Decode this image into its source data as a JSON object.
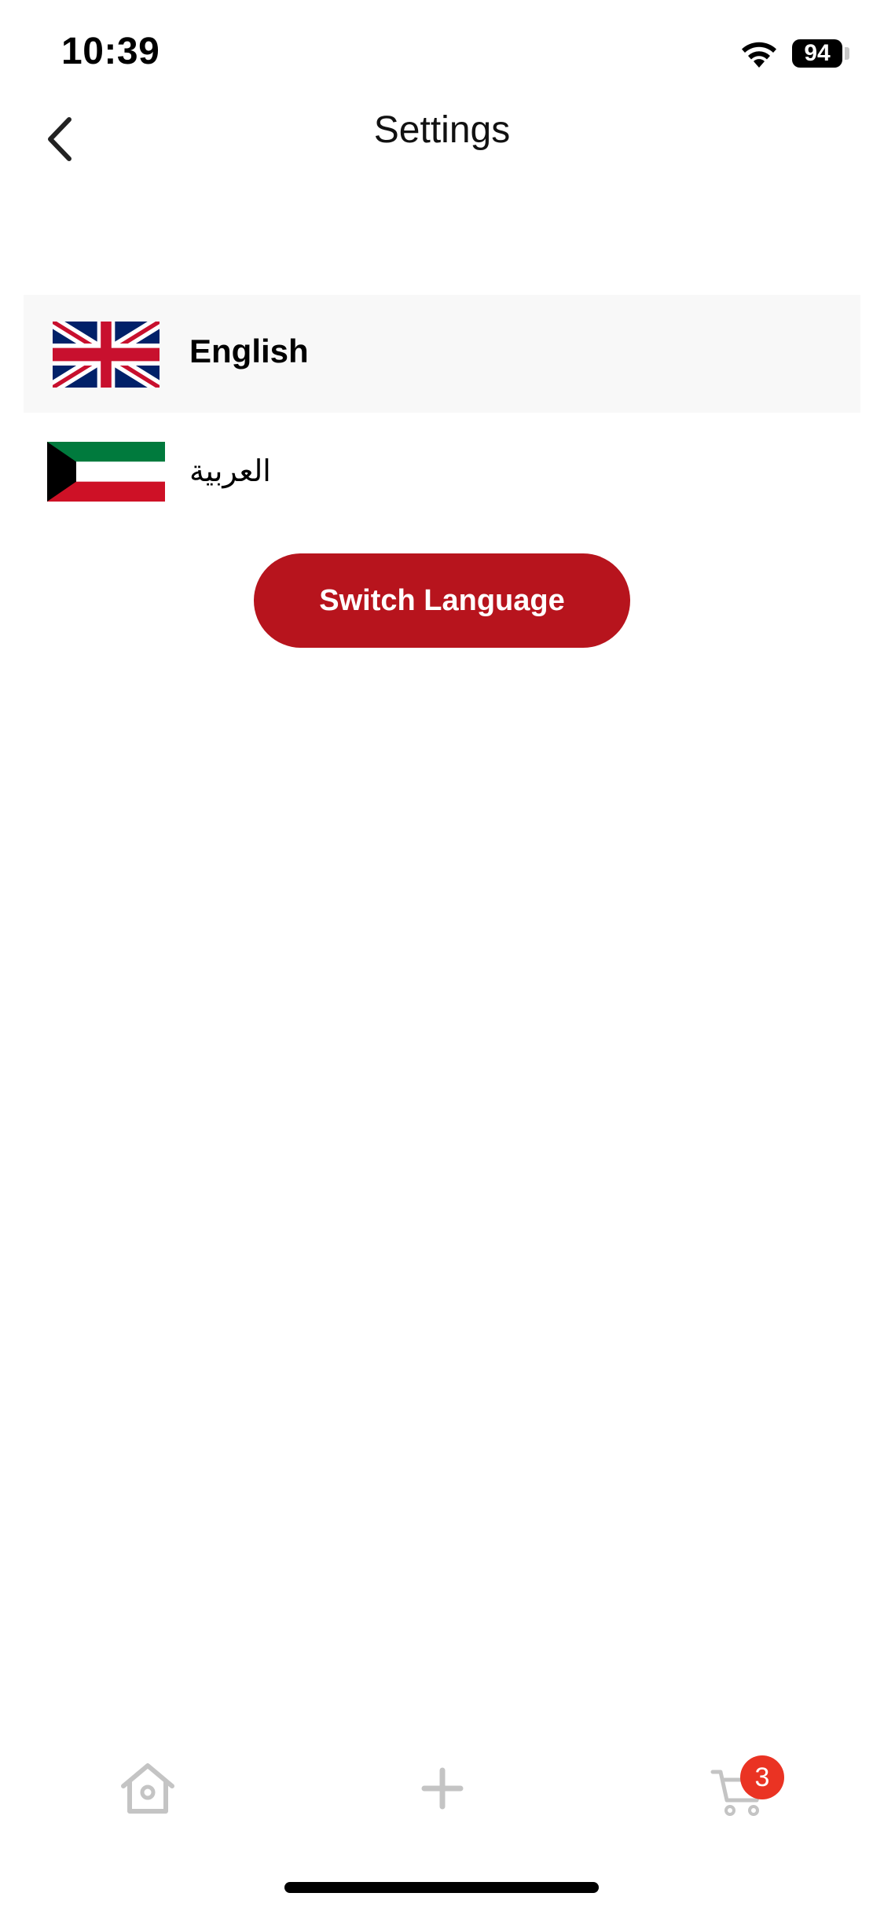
{
  "status_bar": {
    "time": "10:39",
    "battery": "94"
  },
  "nav": {
    "title": "Settings"
  },
  "languages": [
    {
      "label": "English",
      "flag": "uk-flag-icon",
      "selected": true
    },
    {
      "label": "العربية",
      "flag": "kuwait-flag-icon",
      "selected": false
    }
  ],
  "actions": {
    "switch_language_label": "Switch Language"
  },
  "tab_bar": {
    "items": [
      {
        "icon": "home-icon"
      },
      {
        "icon": "plus-icon"
      },
      {
        "icon": "cart-icon"
      }
    ],
    "cart_badge": "3"
  },
  "colors": {
    "accent": "#b7141d",
    "badge": "#ea3323",
    "selected_row_bg": "#f8f8f8",
    "tab_icon": "#c4c4c4"
  }
}
